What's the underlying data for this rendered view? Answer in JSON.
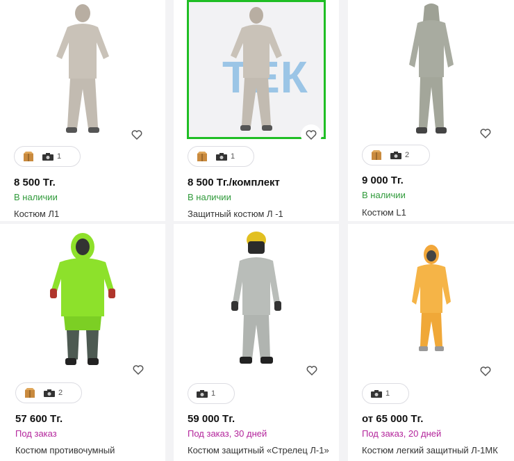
{
  "products": [
    {
      "price": "8 500 Тг.",
      "status": "В наличии",
      "status_type": "ok",
      "title": "Костюм Л1",
      "box_icon": "box-icon",
      "photo_count": "1",
      "image": "light-grey-suit-photo"
    },
    {
      "price": "8 500 Тг./комплект",
      "status": "В наличии",
      "status_type": "ok",
      "title": "Защитный костюм Л -1",
      "box_icon": "box-icon",
      "photo_count": "1",
      "image": "light-grey-suit-photo-with-logo",
      "watermark": "ТЕК"
    },
    {
      "price": "9 000 Тг.",
      "status": "В наличии",
      "status_type": "ok",
      "title": "Костюм L1",
      "box_icon": "box-icon",
      "photo_count": "2",
      "image": "grey-hooded-suit-photo"
    },
    {
      "price": "57 600 Тг.",
      "status": "Под заказ",
      "status_type": "order",
      "title": "Костюм противочумный",
      "box_icon": "box-icon",
      "photo_count": "2",
      "image": "green-hazmat-suit-photo"
    },
    {
      "price": "59 000 Тг.",
      "status": "Под заказ, 30 дней",
      "status_type": "order",
      "title": "Костюм защитный «Стрелец  Л-1»",
      "photo_count": "1",
      "image": "grey-suit-with-helmet-photo"
    },
    {
      "price": "от 65 000 Тг.",
      "status": "Под заказ, 20 дней",
      "status_type": "order",
      "title": "Костюм легкий защитный Л-1МК",
      "photo_count": "1",
      "image": "orange-suit-photo"
    }
  ],
  "colors": {
    "in_stock": "#2f9a3a",
    "on_order": "#b3249b",
    "highlight": "#1fbe24"
  },
  "icons": {
    "favorite": "heart-icon",
    "camera": "camera-icon",
    "box": "box-icon"
  }
}
